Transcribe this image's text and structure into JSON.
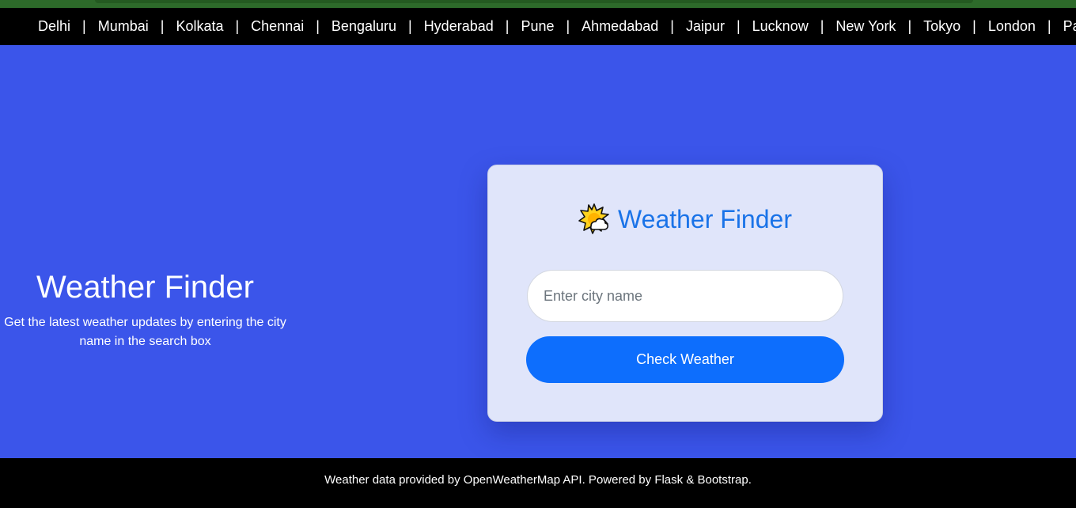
{
  "cities": [
    "Delhi",
    "Mumbai",
    "Kolkata",
    "Chennai",
    "Bengaluru",
    "Hyderabad",
    "Pune",
    "Ahmedabad",
    "Jaipur",
    "Lucknow",
    "New York",
    "Tokyo",
    "London",
    "Pa"
  ],
  "separator": "|",
  "hero": {
    "title": "Weather Finder",
    "subtitle": "Get the latest weather updates by entering the city name in the search box"
  },
  "card": {
    "icon": "sun-behind-cloud-icon",
    "title": "Weather Finder",
    "input_placeholder": "Enter city name",
    "input_value": "",
    "button_label": "Check Weather"
  },
  "footer": {
    "text": "Weather data provided by OpenWeatherMap API. Powered by Flask & Bootstrap."
  },
  "colors": {
    "page_bg": "#3b55ea",
    "card_bg": "#e0e5fa",
    "title_blue": "#1a73e8",
    "button_bg": "#0d6efd",
    "bar_bg": "#000000",
    "top_strip": "#2d6a2a"
  }
}
